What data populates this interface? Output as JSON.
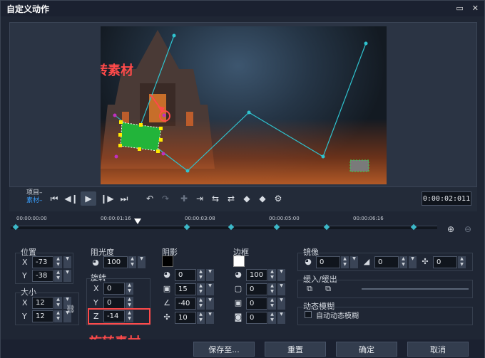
{
  "window": {
    "title": "自定义动作"
  },
  "annotations": {
    "drag_hint": "拖拽旋转素材",
    "rotate_hint": "旋转素材"
  },
  "transport": {
    "project_label": "项目–",
    "clip_label": "素材–",
    "timecode": "0:00:02:011"
  },
  "timeline": {
    "ruler": [
      "00:00:00:00",
      "00:00:01:16",
      "00:00:03:08",
      "00:00:05:00",
      "00:00:06:16"
    ]
  },
  "position": {
    "title": "位置",
    "x_label": "X",
    "x": "-73",
    "y_label": "Y",
    "y": "-38"
  },
  "size": {
    "title": "大小",
    "x_label": "X",
    "x": "12",
    "y_label": "Y",
    "y": "12"
  },
  "opacity": {
    "title": "阻光度",
    "value": "100"
  },
  "rotation": {
    "title": "旋转",
    "x_label": "X",
    "x": "0",
    "y_label": "Y",
    "y": "0",
    "z_label": "Z",
    "z": "-14"
  },
  "shadow": {
    "title": "阴影",
    "opacity": "0",
    "blur": "15",
    "angle": "-40",
    "distance": "10",
    "color": "#000000"
  },
  "border": {
    "title": "边框",
    "opacity": "100",
    "v1": "0",
    "v2": "0",
    "v3": "0",
    "color": "#ffffff"
  },
  "mirror": {
    "title": "镜像",
    "v1": "0",
    "v2": "0",
    "v3": "0"
  },
  "ease": {
    "title": "缓入/缓出"
  },
  "motion_blur": {
    "title": "动态模糊",
    "checkbox_label": "自动动态模糊"
  },
  "buttons": {
    "save_to": "保存至...",
    "reset": "重置",
    "ok": "确定",
    "cancel": "取消"
  },
  "colors": {
    "accent_path": "#2fc4d0",
    "annotation": "#ff4a4a",
    "selected_clip": "#22b43a",
    "handle": "#ffea00"
  }
}
